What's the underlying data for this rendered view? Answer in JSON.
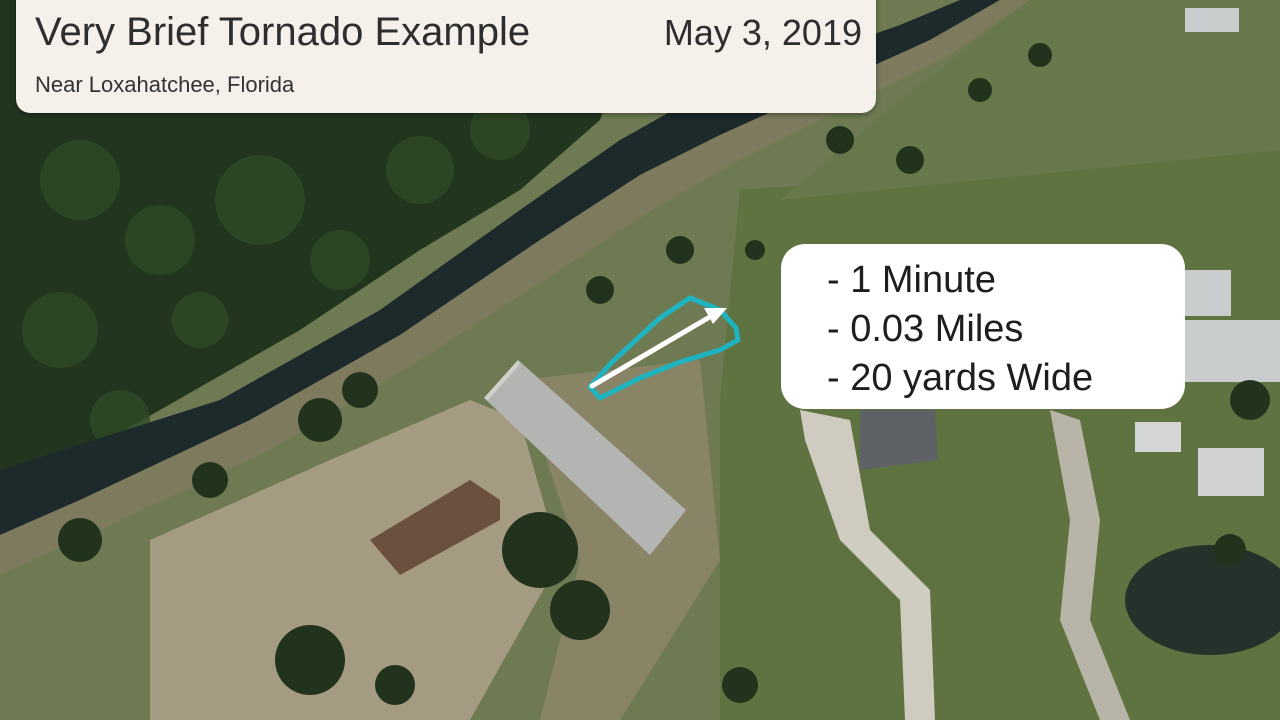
{
  "header": {
    "title": "Very Brief Tornado Example",
    "date": "May 3, 2019",
    "location": "Near Loxahatchee, Florida"
  },
  "stats": [
    {
      "label": "- 1 Minute"
    },
    {
      "label": "- 0.03 Miles"
    },
    {
      "label": "- 20 yards Wide"
    }
  ],
  "colors": {
    "damage_outline": "#1fb3c0",
    "track_arrow": "#ffffff",
    "card_bg": "#f5f0ea"
  }
}
